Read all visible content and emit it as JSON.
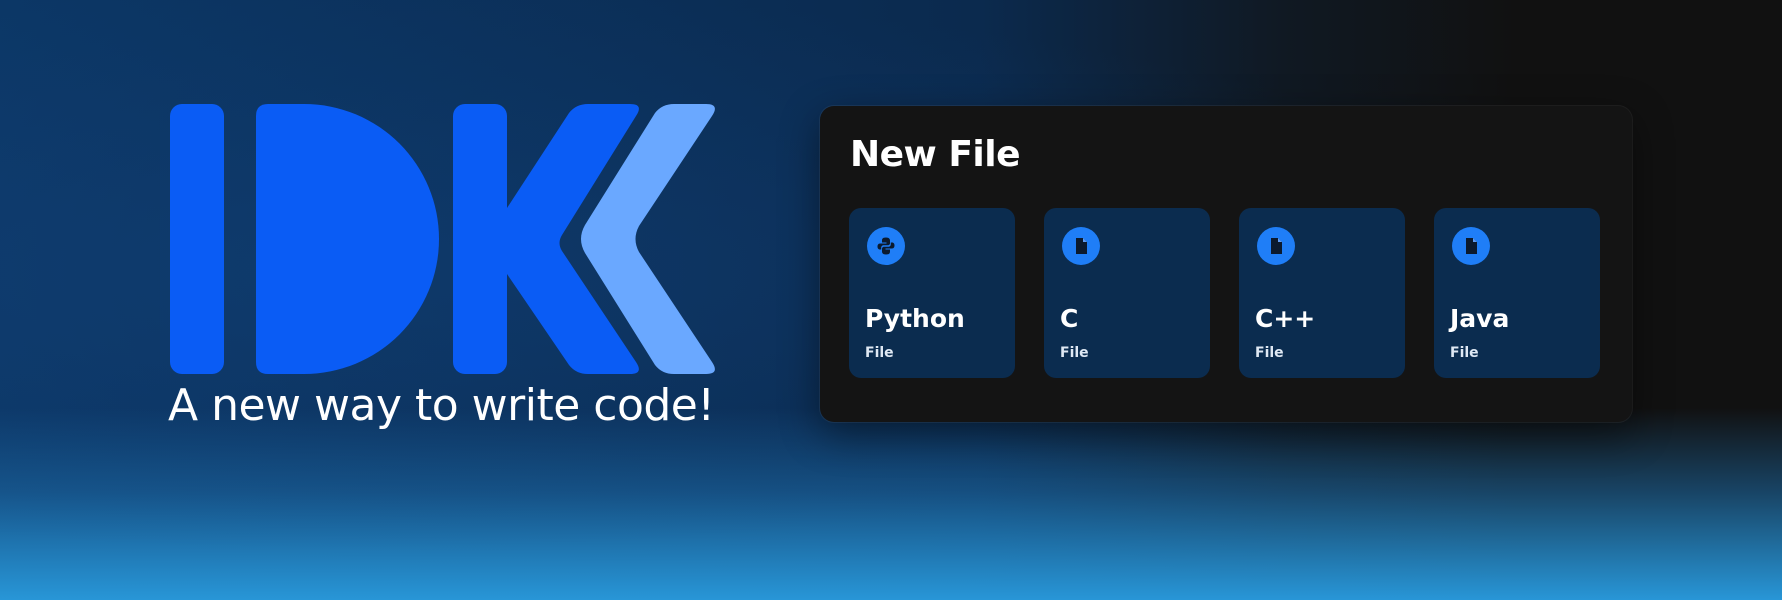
{
  "brand": {
    "logo_text": "IDK",
    "tagline": "A new way to write code!",
    "colors": {
      "primary": "#0a5cf5",
      "secondary": "#6aa8ff"
    }
  },
  "new_file_panel": {
    "title": "New File",
    "cards": [
      {
        "label": "Python",
        "sub": "File",
        "icon": "python-icon"
      },
      {
        "label": "C",
        "sub": "File",
        "icon": "file-icon"
      },
      {
        "label": "C++",
        "sub": "File",
        "icon": "file-icon"
      },
      {
        "label": "Java",
        "sub": "File",
        "icon": "file-icon"
      }
    ]
  }
}
